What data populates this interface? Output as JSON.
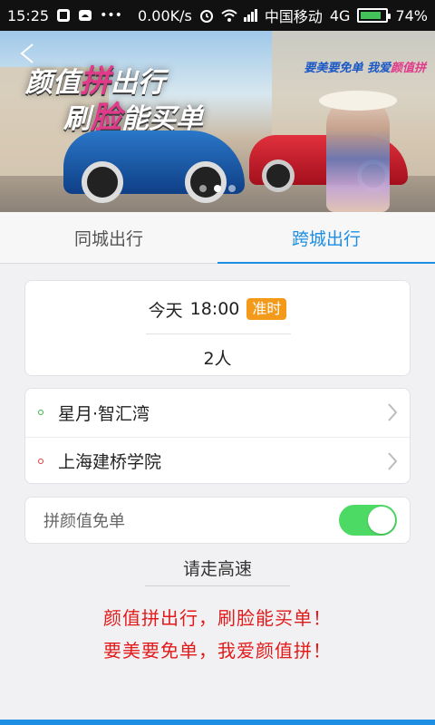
{
  "status_bar": {
    "time": "15:25",
    "speed": "0.00K/s",
    "carrier": "中国移动",
    "network": "4G",
    "battery": "74%",
    "battery_level": 0.74,
    "icons": [
      "notification-icon",
      "cloud-icon",
      "more-icon",
      "alarm-icon",
      "wifi-icon",
      "signal-icon",
      "battery-icon"
    ]
  },
  "banner": {
    "headline_part1": "颜值",
    "headline_highlight1": "拼",
    "headline_part2": "出行",
    "headline2_part1": "刷",
    "headline_highlight2": "脸",
    "headline2_part2": "能买单",
    "slogan_part1": "要美要免单",
    "slogan_part2": "我爱",
    "slogan_highlight": "颜值拼",
    "dots_total": 3,
    "active_dot": 1
  },
  "tabs": [
    {
      "label": "同城出行",
      "active": false
    },
    {
      "label": "跨城出行",
      "active": true
    }
  ],
  "trip": {
    "day": "今天",
    "time": "18:00",
    "badge": "准时",
    "people": "2人"
  },
  "route": {
    "from": "星月·智汇湾",
    "to": "上海建桥学院",
    "from_color": "#3bb54a",
    "to_color": "#e23b3b"
  },
  "toggle": {
    "label": "拼颜值免单",
    "on": true
  },
  "highway": "请走高速",
  "promo": {
    "line1": "颜值拼出行，刷脸能买单！",
    "line2": "要美要免单，我爱颜值拼！"
  },
  "colors": {
    "accent": "#1e8ee3",
    "badge": "#f39a1b",
    "promo": "#e21a1a",
    "switch_on": "#4cd964"
  }
}
